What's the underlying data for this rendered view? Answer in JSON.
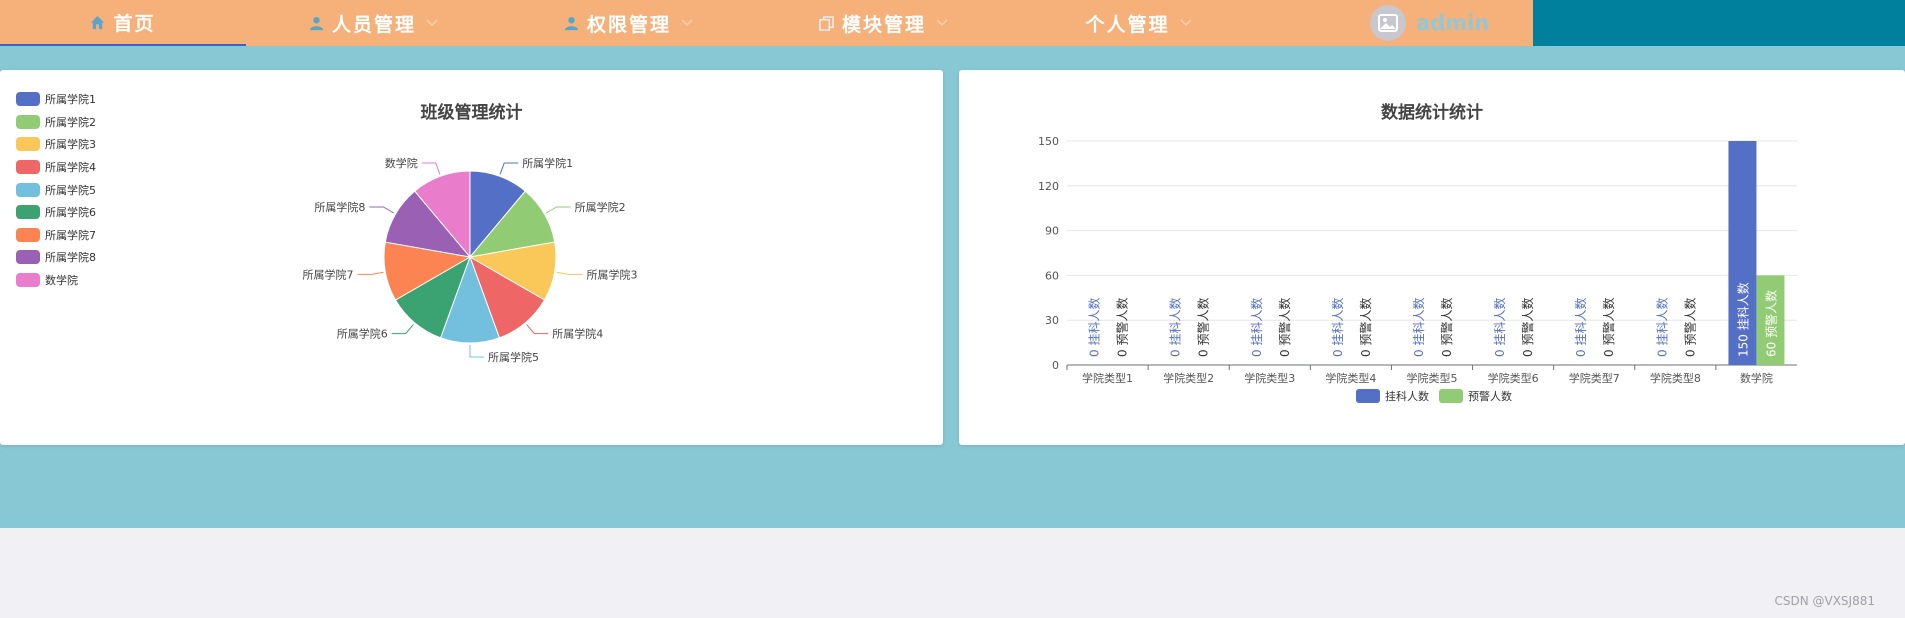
{
  "nav": {
    "items": [
      {
        "label": "首页",
        "icon": "home-icon",
        "active": true,
        "has_dropdown": false
      },
      {
        "label": "人员管理",
        "icon": "user-icon",
        "active": false,
        "has_dropdown": true
      },
      {
        "label": "权限管理",
        "icon": "user-icon",
        "active": false,
        "has_dropdown": true
      },
      {
        "label": "模块管理",
        "icon": "copy-icon",
        "active": false,
        "has_dropdown": true
      },
      {
        "label": "个人管理",
        "icon": "",
        "active": false,
        "has_dropdown": true
      }
    ],
    "user": {
      "name": "admin",
      "avatar_icon": "image-icon"
    }
  },
  "pie_card": {
    "title": "班级管理统计"
  },
  "bar_card": {
    "title": "数据统计统计"
  },
  "watermark": "CSDN @VXSJ881",
  "colors": {
    "nav_bg": "#f6b079",
    "nav_right": "#00809d",
    "page_bg": "#88c8d5",
    "series": [
      "#5470c6",
      "#91cc75",
      "#fac858",
      "#ee6666",
      "#73c0de",
      "#3ba272",
      "#fc8452",
      "#9a60b4",
      "#ea7ccc"
    ]
  },
  "chart_data": [
    {
      "type": "pie",
      "title": "班级管理统计",
      "legend_position": "left",
      "categories": [
        "所属学院1",
        "所属学院2",
        "所属学院3",
        "所属学院4",
        "所属学院5",
        "所属学院6",
        "所属学院7",
        "所属学院8",
        "数学院"
      ],
      "values": [
        1,
        1,
        1,
        1,
        1,
        1,
        1,
        1,
        1
      ]
    },
    {
      "type": "bar",
      "title": "数据统计统计",
      "categories": [
        "学院类型1",
        "学院类型2",
        "学院类型3",
        "学院类型4",
        "学院类型5",
        "学院类型6",
        "学院类型7",
        "学院类型8",
        "数学院"
      ],
      "series": [
        {
          "name": "挂科人数",
          "values": [
            0,
            0,
            0,
            0,
            0,
            0,
            0,
            0,
            150
          ]
        },
        {
          "name": "预警人数",
          "values": [
            0,
            0,
            0,
            0,
            0,
            0,
            0,
            0,
            60
          ]
        }
      ],
      "ylim": [
        0,
        150
      ],
      "yticks": [
        0,
        30,
        60,
        90,
        120,
        150
      ],
      "grid": true,
      "legend_position": "bottom"
    }
  ]
}
